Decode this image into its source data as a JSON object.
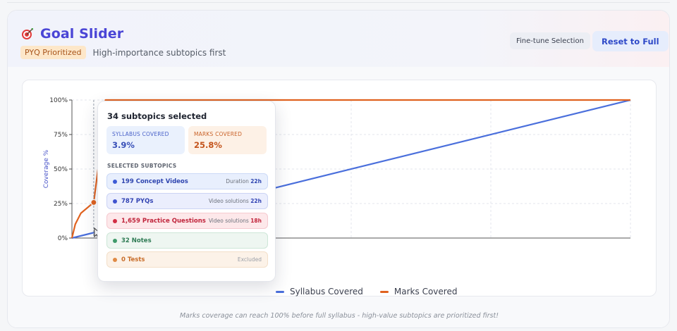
{
  "header": {
    "title": "Goal Slider",
    "badge": "PYQ Prioritized",
    "subtitle": "High-importance subtopics first",
    "fine_tune_label": "Fine-tune Selection",
    "reset_label": "Reset to Full"
  },
  "tooltip": {
    "title": "34 subtopics selected",
    "syllabus": {
      "label": "SYLLABUS COVERED",
      "value": "3.9%"
    },
    "marks": {
      "label": "MARKS COVERED",
      "value": "25.8%"
    },
    "section_label": "SELECTED SUBTOPICS",
    "rows": [
      {
        "label": "199 Concept Videos",
        "meta_prefix": "Duration",
        "meta_value": "22h"
      },
      {
        "label": "787 PYQs",
        "meta_prefix": "Video solutions",
        "meta_value": "22h"
      },
      {
        "label": "1,659 Practice Questions",
        "meta_prefix": "Video solutions",
        "meta_value": "18h"
      },
      {
        "label": "32 Notes",
        "meta_prefix": "",
        "meta_value": ""
      },
      {
        "label": "0 Tests",
        "meta_prefix": "Excluded",
        "meta_value": ""
      }
    ]
  },
  "chart_data": {
    "type": "line",
    "ylabel": "Coverage %",
    "y_ticks": [
      "0%",
      "25%",
      "50%",
      "75%",
      "100%"
    ],
    "ylim": [
      0,
      100
    ],
    "xlim": [
      0,
      100
    ],
    "grid": true,
    "legend_position": "bottom-center",
    "series": [
      {
        "name": "Syllabus Covered",
        "color": "#4a6fdc",
        "x": [
          0,
          3.9,
          100
        ],
        "y": [
          0,
          3.9,
          100
        ]
      },
      {
        "name": "Marks Covered",
        "color": "#e0621f",
        "x": [
          0,
          0.6,
          1.6,
          3.9,
          5,
          6,
          100
        ],
        "y": [
          0,
          10,
          18,
          25.8,
          60,
          100,
          100
        ]
      }
    ],
    "marker": {
      "x": 3.9,
      "y": 25.8,
      "color": "#e0621f"
    }
  },
  "legend": {
    "syllabus_label": "Syllabus Covered",
    "marks_label": "Marks Covered"
  },
  "footer": {
    "note": "Marks coverage can reach 100% before full syllabus - high-value subtopics are prioritized first!"
  }
}
